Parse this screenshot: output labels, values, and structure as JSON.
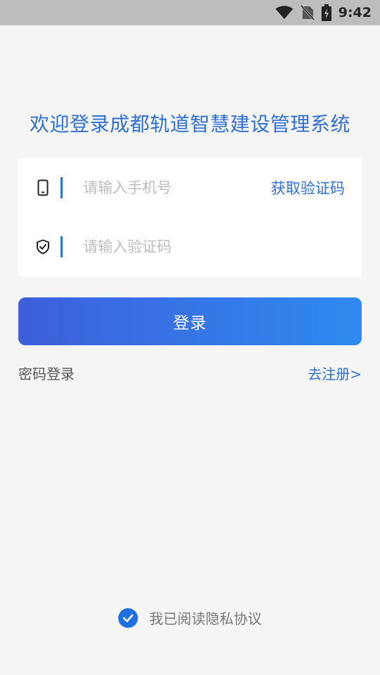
{
  "status_bar": {
    "time": "9:42",
    "icons": [
      "wifi-icon",
      "no-sim-icon",
      "battery-charging-icon"
    ]
  },
  "welcome_title": "欢迎登录成都轨道智慧建设管理系统",
  "form": {
    "phone_placeholder": "请输入手机号",
    "phone_value": "",
    "phone_icon": "phone-icon",
    "get_code_label": "获取验证码",
    "code_placeholder": "请输入验证码",
    "code_value": "",
    "code_icon": "shield-icon"
  },
  "login_button_label": "登录",
  "links": {
    "password_login": "密码登录",
    "register": "去注册>"
  },
  "agreement": {
    "checked": true,
    "label": "我已阅读隐私协议"
  },
  "colors": {
    "accent": "#2f6fd6",
    "button_gradient_start": "#3d5fd9",
    "button_gradient_end": "#2f8af0",
    "background": "#f5f5f5",
    "status_bar": "#bdbdbd"
  }
}
